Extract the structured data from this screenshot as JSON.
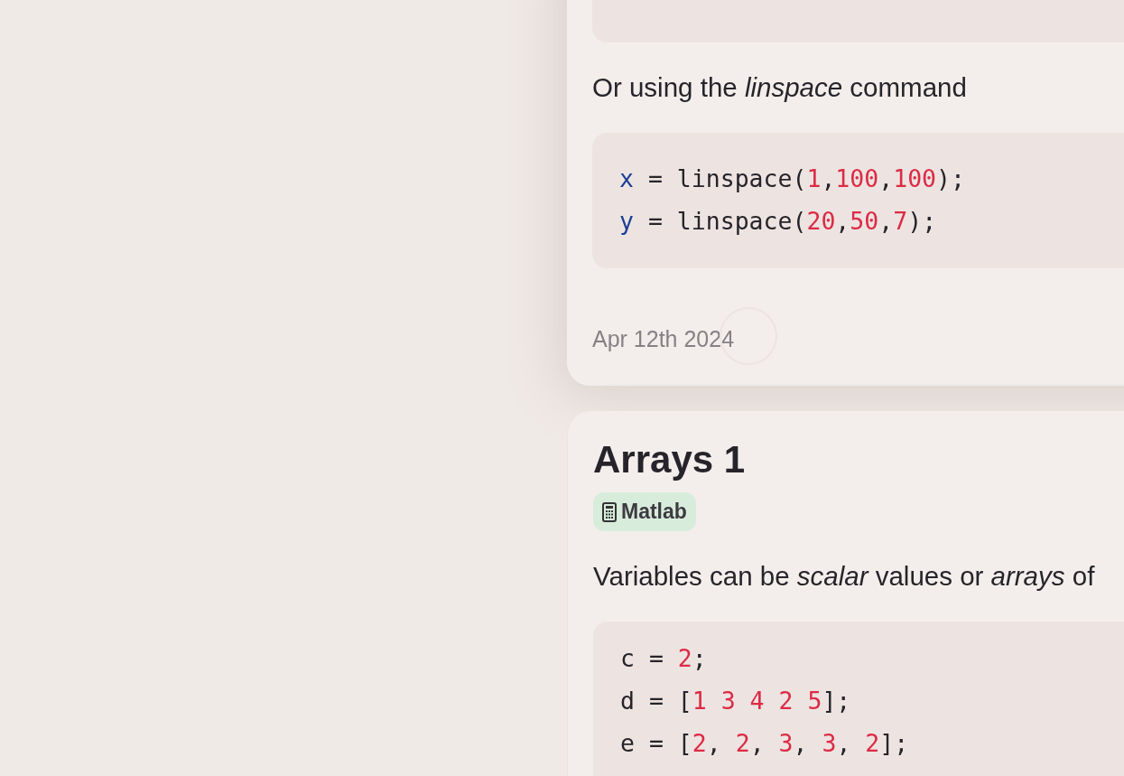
{
  "cards": [
    {
      "blocks": [
        {
          "kind": "paragraph",
          "text": "Or using the *linspace* command"
        },
        {
          "kind": "code",
          "lines": [
            [
              {
                "t": "x",
                "kind": "var"
              },
              {
                "t": " = linspace(",
                "kind": "text"
              },
              {
                "t": "1",
                "kind": "num"
              },
              {
                "t": ",",
                "kind": "text"
              },
              {
                "t": "100",
                "kind": "num"
              },
              {
                "t": ",",
                "kind": "text"
              },
              {
                "t": "100",
                "kind": "num"
              },
              {
                "t": ");",
                "kind": "text"
              }
            ],
            [
              {
                "t": "y",
                "kind": "var"
              },
              {
                "t": " = linspace(",
                "kind": "text"
              },
              {
                "t": "20",
                "kind": "num"
              },
              {
                "t": ",",
                "kind": "text"
              },
              {
                "t": "50",
                "kind": "num"
              },
              {
                "t": ",",
                "kind": "text"
              },
              {
                "t": "7",
                "kind": "num"
              },
              {
                "t": ");",
                "kind": "text"
              }
            ]
          ]
        },
        {
          "kind": "date",
          "text": "Apr 12th 2024"
        }
      ]
    },
    {
      "blocks": [
        {
          "kind": "title",
          "text": "Arrays 1"
        },
        {
          "kind": "tag",
          "text": "Matlab"
        },
        {
          "kind": "paragraph",
          "text": "Variables can be *scalar* values or *arrays* of"
        },
        {
          "kind": "code",
          "lines": [
            [
              {
                "t": "c = ",
                "kind": "text"
              },
              {
                "t": "2",
                "kind": "num"
              },
              {
                "t": ";",
                "kind": "text"
              }
            ],
            [
              {
                "t": "d = [",
                "kind": "text"
              },
              {
                "t": "1 3 4 2 5",
                "kind": "num"
              },
              {
                "t": "];",
                "kind": "text"
              }
            ],
            [
              {
                "t": "e = [",
                "kind": "text"
              },
              {
                "t": "2",
                "kind": "num"
              },
              {
                "t": ", ",
                "kind": "text"
              },
              {
                "t": "2",
                "kind": "num"
              },
              {
                "t": ", ",
                "kind": "text"
              },
              {
                "t": "3",
                "kind": "num"
              },
              {
                "t": ", ",
                "kind": "text"
              },
              {
                "t": "3",
                "kind": "num"
              },
              {
                "t": ", ",
                "kind": "text"
              },
              {
                "t": "2",
                "kind": "num"
              },
              {
                "t": "];",
                "kind": "text"
              }
            ]
          ]
        }
      ]
    }
  ]
}
